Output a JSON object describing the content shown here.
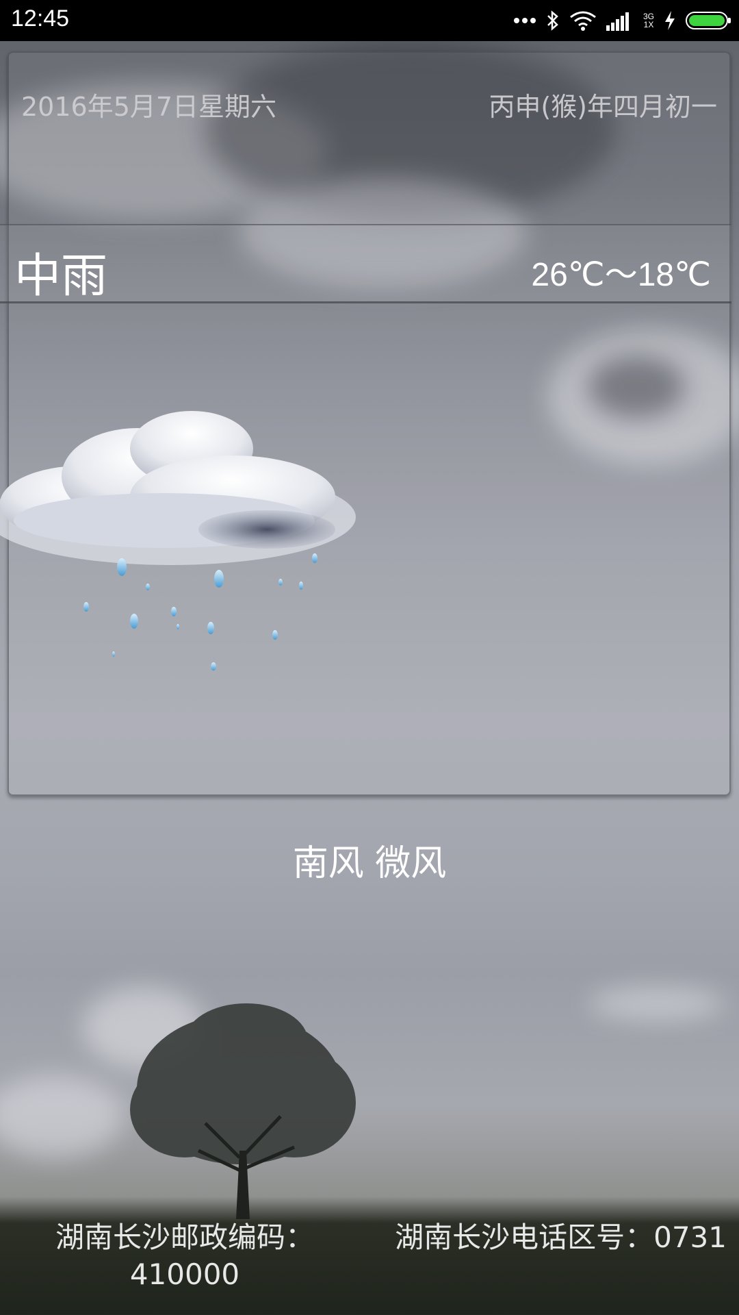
{
  "status_bar": {
    "time": "12:45",
    "network_top": "3G",
    "network_bottom": "1X",
    "battery_level": 1.0,
    "icons": [
      "more-dots-icon",
      "bluetooth-icon",
      "wifi-icon",
      "signal-icon",
      "charging-icon",
      "battery-icon"
    ]
  },
  "date": {
    "gregorian": "2016年5月7日星期六",
    "lunar": "丙申(猴)年四月初一"
  },
  "weather": {
    "condition": "中雨",
    "temperature_range": "26℃～18℃",
    "icon": "cloud-rain-icon",
    "wind": "南风 微风"
  },
  "footer": {
    "postal_label": "湖南长沙邮政编码：",
    "postal_code": "410000",
    "area_code_text": "湖南长沙电话区号：0731"
  },
  "colors": {
    "status_bar_bg": "#000000",
    "battery_fill": "#3fd43f",
    "text_primary": "#ffffff",
    "text_date": "#cdcdd2"
  }
}
